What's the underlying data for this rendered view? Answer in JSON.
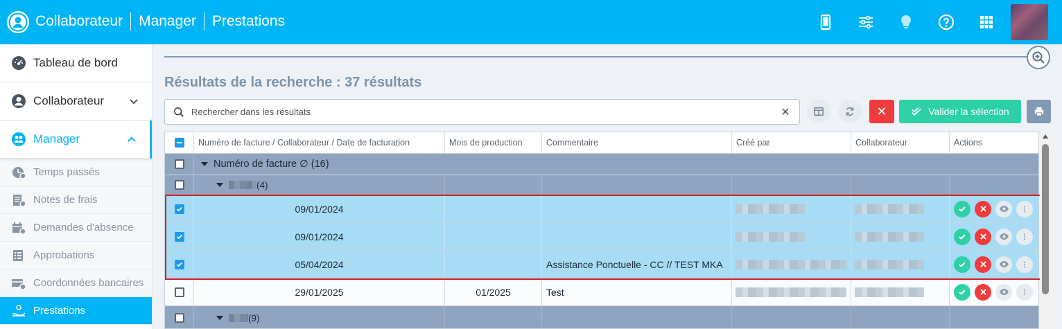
{
  "app": {
    "breadcrumb": [
      "Collaborateur",
      "Manager",
      "Prestations"
    ],
    "top_icons": [
      "mobile-icon",
      "sliders-icon",
      "lightbulb-icon",
      "help-icon",
      "apps-grid-icon"
    ]
  },
  "sidebar": {
    "main": [
      {
        "label": "Tableau de bord",
        "icon": "dashboard-icon"
      },
      {
        "label": "Collaborateur",
        "icon": "user-icon"
      },
      {
        "label": "Manager",
        "icon": "manager-icon"
      }
    ],
    "sub": [
      {
        "label": "Temps passés",
        "icon": "clock-icon"
      },
      {
        "label": "Notes de frais",
        "icon": "receipt-icon"
      },
      {
        "label": "Demandes d'absence",
        "icon": "calendar-icon"
      },
      {
        "label": "Approbations",
        "icon": "list-icon"
      },
      {
        "label": "Coordonnées bancaires",
        "icon": "bank-card-icon"
      },
      {
        "label": "Prestations",
        "icon": "hand-icon"
      }
    ]
  },
  "main": {
    "results_title": "Résultats de la recherche : 37 résultats",
    "search_placeholder": "Rechercher dans les résultats",
    "validate_label": "Valider la sélection"
  },
  "table": {
    "columns": [
      "Numéro de facture / Collaborateur / Date de facturation",
      "Mois de production",
      "Commentaire",
      "Créé par",
      "Collaborateur",
      "Actions"
    ],
    "group1_label": "Numéro de facture ∅ (16)",
    "subgroup1_count": "(4)",
    "rows": [
      {
        "date": "09/01/2024",
        "mois": "",
        "commentaire": ""
      },
      {
        "date": "09/01/2024",
        "mois": "",
        "commentaire": ""
      },
      {
        "date": "05/04/2024",
        "mois": "",
        "commentaire": "Assistance Ponctuelle - CC // TEST MKA"
      },
      {
        "date": "29/01/2025",
        "mois": "01/2025",
        "commentaire": "Test"
      }
    ],
    "subgroup2_count": "(9)"
  },
  "colors": {
    "primary": "#00b4f5",
    "accent_green": "#2ed1a6",
    "accent_red": "#f03c3c",
    "group_row": "#8fa5bf",
    "selected_row": "#a8dcf5"
  }
}
